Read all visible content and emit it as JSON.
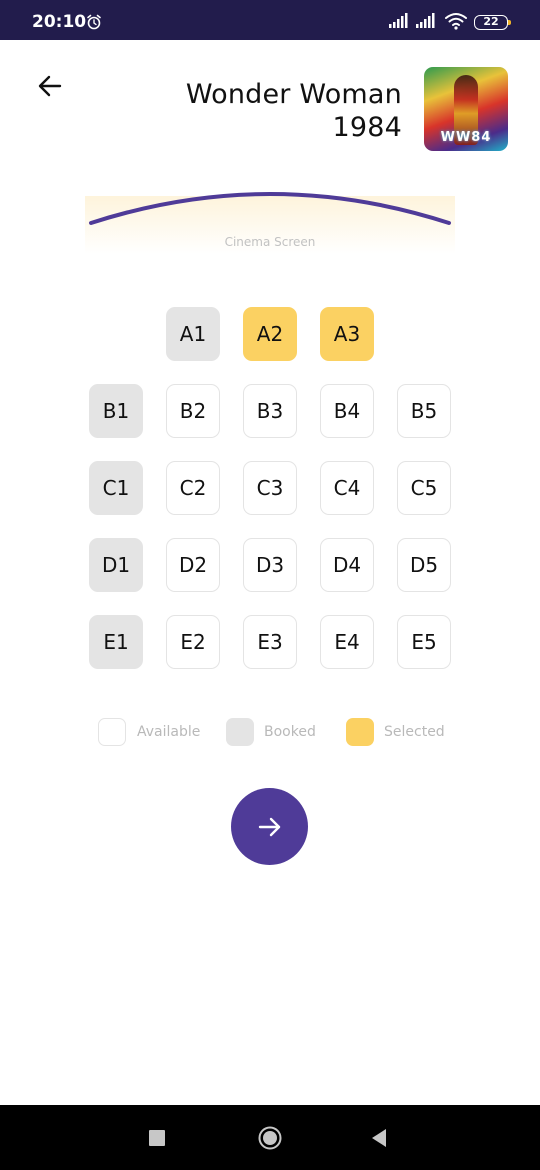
{
  "status_bar": {
    "time": "20:10",
    "battery_level": "22",
    "icons": [
      "alarm-icon",
      "signal-icon",
      "signal-icon",
      "wifi-icon",
      "battery-icon"
    ]
  },
  "header": {
    "back_icon": "arrow-left-icon",
    "title_line1": "Wonder Woman",
    "title_line2": "1984",
    "poster_text": "WW84"
  },
  "screen": {
    "label": "Cinema Screen",
    "curve_color": "#4f3b98"
  },
  "seats": {
    "rows": [
      [
        {
          "label": "A1",
          "status": "booked"
        },
        {
          "label": "A2",
          "status": "selected"
        },
        {
          "label": "A3",
          "status": "selected"
        }
      ],
      [
        {
          "label": "B1",
          "status": "booked"
        },
        {
          "label": "B2",
          "status": "available"
        },
        {
          "label": "B3",
          "status": "available"
        },
        {
          "label": "B4",
          "status": "available"
        },
        {
          "label": "B5",
          "status": "available"
        }
      ],
      [
        {
          "label": "C1",
          "status": "booked"
        },
        {
          "label": "C2",
          "status": "available"
        },
        {
          "label": "C3",
          "status": "available"
        },
        {
          "label": "C4",
          "status": "available"
        },
        {
          "label": "C5",
          "status": "available"
        }
      ],
      [
        {
          "label": "D1",
          "status": "booked"
        },
        {
          "label": "D2",
          "status": "available"
        },
        {
          "label": "D3",
          "status": "available"
        },
        {
          "label": "D4",
          "status": "available"
        },
        {
          "label": "D5",
          "status": "available"
        }
      ],
      [
        {
          "label": "E1",
          "status": "booked"
        },
        {
          "label": "E2",
          "status": "available"
        },
        {
          "label": "E3",
          "status": "available"
        },
        {
          "label": "E4",
          "status": "available"
        },
        {
          "label": "E5",
          "status": "available"
        }
      ]
    ]
  },
  "legend": {
    "available": "Available",
    "booked": "Booked",
    "selected": "Selected"
  },
  "colors": {
    "accent": "#4f3b98",
    "selected": "#fbd162",
    "booked": "#e4e4e4",
    "status_bar": "#221c4c"
  },
  "next_button": {
    "icon": "arrow-right-icon"
  },
  "nav_bar": {
    "icons": [
      "recents-icon",
      "home-icon",
      "back-icon"
    ]
  }
}
